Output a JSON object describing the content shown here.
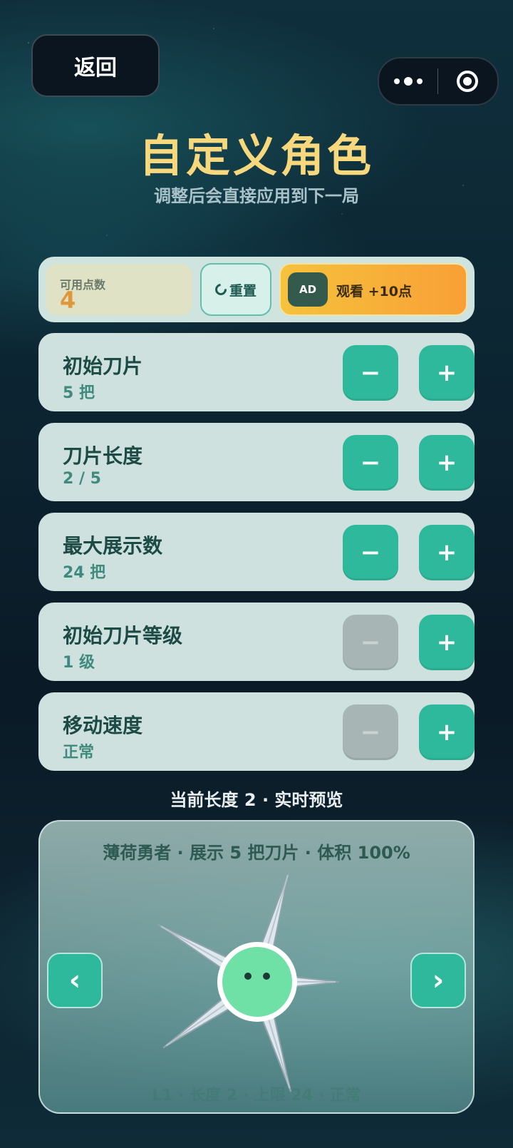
{
  "nav": {
    "back_label": "返回",
    "menu_icon": "more-dots-icon",
    "close_icon": "target-icon"
  },
  "header": {
    "title": "自定义角色",
    "subtitle": "调整后会直接应用到下一局"
  },
  "points": {
    "label": "可用点数",
    "value": "4",
    "reset_label": "重置",
    "ad_badge": "AD",
    "ad_label": "观看 +10点"
  },
  "stats": [
    {
      "name": "初始刀片",
      "value": "5 把",
      "minus_enabled": true,
      "plus_enabled": true
    },
    {
      "name": "刀片长度",
      "value": "2 / 5",
      "minus_enabled": true,
      "plus_enabled": true
    },
    {
      "name": "最大展示数",
      "value": "24 把",
      "minus_enabled": true,
      "plus_enabled": true
    },
    {
      "name": "初始刀片等级",
      "value": "1 级",
      "minus_enabled": false,
      "plus_enabled": true
    },
    {
      "name": "移动速度",
      "value": "正常",
      "minus_enabled": false,
      "plus_enabled": true
    }
  ],
  "buttons": {
    "minus": "−",
    "plus": "+"
  },
  "preview": {
    "caption": "当前长度 2 · 实时预览",
    "info": "薄荷勇者 · 展示 5 把刀片 · 体积 100%",
    "prev_label": "‹",
    "next_label": "›",
    "footer": "L1 · 长度 2 · 上限 24 · 正常",
    "colors": {
      "body": "#6fe0a6",
      "body_ring": "#ffffff",
      "blade": "#dfe7ee",
      "guard": "#2e3a3e"
    }
  }
}
